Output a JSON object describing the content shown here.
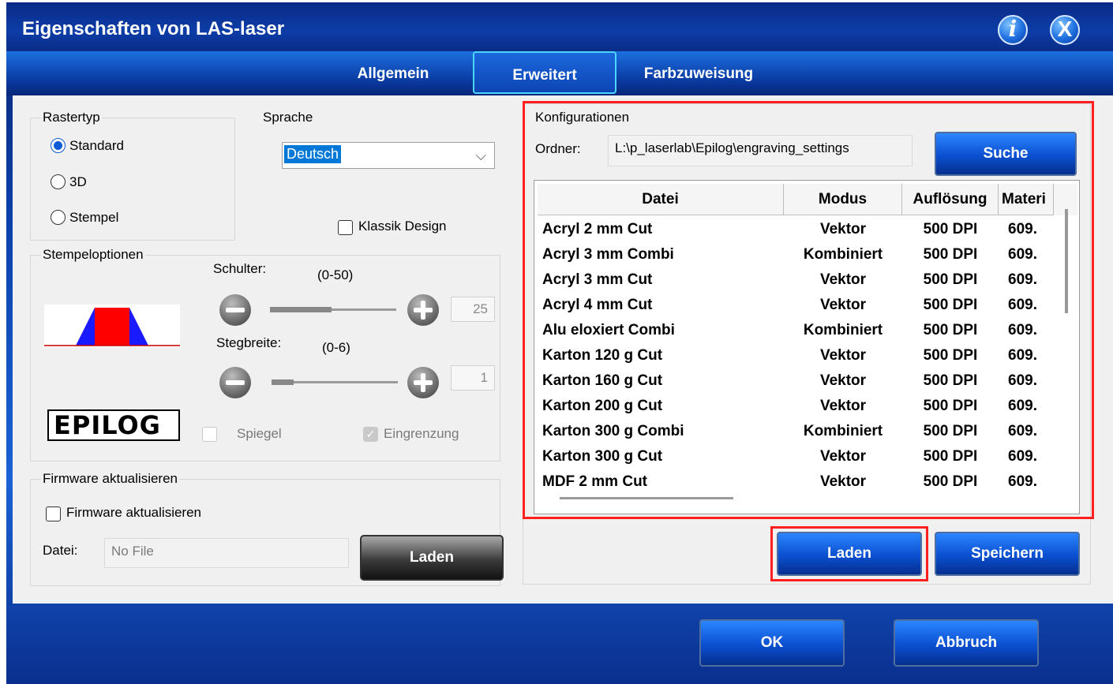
{
  "window": {
    "title": "Eigenschaften von LAS-laser",
    "info_glyph": "i",
    "close_glyph": "X"
  },
  "tabs": [
    {
      "label": "Allgemein"
    },
    {
      "label": "Erweitert"
    },
    {
      "label": "Farbzuweisung"
    }
  ],
  "rastertyp": {
    "legend": "Rastertyp",
    "options": [
      {
        "label": "Standard",
        "selected": true
      },
      {
        "label": "3D",
        "selected": false
      },
      {
        "label": "Stempel",
        "selected": false
      }
    ]
  },
  "sprache": {
    "label": "Sprache",
    "value": "Deutsch"
  },
  "klassik_design": {
    "label": "Klassik Design",
    "checked": false
  },
  "stempeloptionen": {
    "legend": "Stempeloptionen",
    "schulter": {
      "label": "Schulter:",
      "range": "(0-50)",
      "value": "25"
    },
    "stegbreite": {
      "label": "Stegbreite:",
      "range": "(0-6)",
      "value": "1"
    },
    "logo_text": "EPILOG",
    "spiegel": {
      "label": "Spiegel",
      "checked": false
    },
    "eingrenzung": {
      "label": "Eingrenzung",
      "checked": true
    }
  },
  "firmware": {
    "legend": "Firmware aktualisieren",
    "checkbox_label": "Firmware aktualisieren",
    "datei_label": "Datei:",
    "file_value": "No File",
    "laden_label": "Laden"
  },
  "konfigurationen": {
    "legend": "Konfigurationen",
    "ordner_label": "Ordner:",
    "ordner_value": "L:\\p_laserlab\\Epilog\\engraving_settings",
    "suche_label": "Suche",
    "columns": [
      "Datei",
      "Modus",
      "Auflösung",
      "Materi"
    ],
    "rows": [
      [
        "Acryl 2 mm Cut",
        "Vektor",
        "500 DPI",
        "609."
      ],
      [
        "Acryl 3 mm Combi",
        "Kombiniert",
        "500 DPI",
        "609."
      ],
      [
        "Acryl 3 mm Cut",
        "Vektor",
        "500 DPI",
        "609."
      ],
      [
        "Acryl 4 mm Cut",
        "Vektor",
        "500 DPI",
        "609."
      ],
      [
        "Alu eloxiert Combi",
        "Kombiniert",
        "500 DPI",
        "609."
      ],
      [
        "Karton 120 g Cut",
        "Vektor",
        "500 DPI",
        "609."
      ],
      [
        "Karton 160 g Cut",
        "Vektor",
        "500 DPI",
        "609."
      ],
      [
        "Karton 200 g Cut",
        "Vektor",
        "500 DPI",
        "609."
      ],
      [
        "Karton 300 g Combi",
        "Kombiniert",
        "500 DPI",
        "609."
      ],
      [
        "Karton 300 g Cut",
        "Vektor",
        "500 DPI",
        "609."
      ],
      [
        "MDF 2 mm Cut",
        "Vektor",
        "500 DPI",
        "609."
      ]
    ],
    "laden_label": "Laden",
    "speichern_label": "Speichern"
  },
  "footer": {
    "ok_label": "OK",
    "abbruch_label": "Abbruch"
  },
  "colors": {
    "highlight": "#ff1f1f",
    "accent": "#0b4fd0"
  }
}
